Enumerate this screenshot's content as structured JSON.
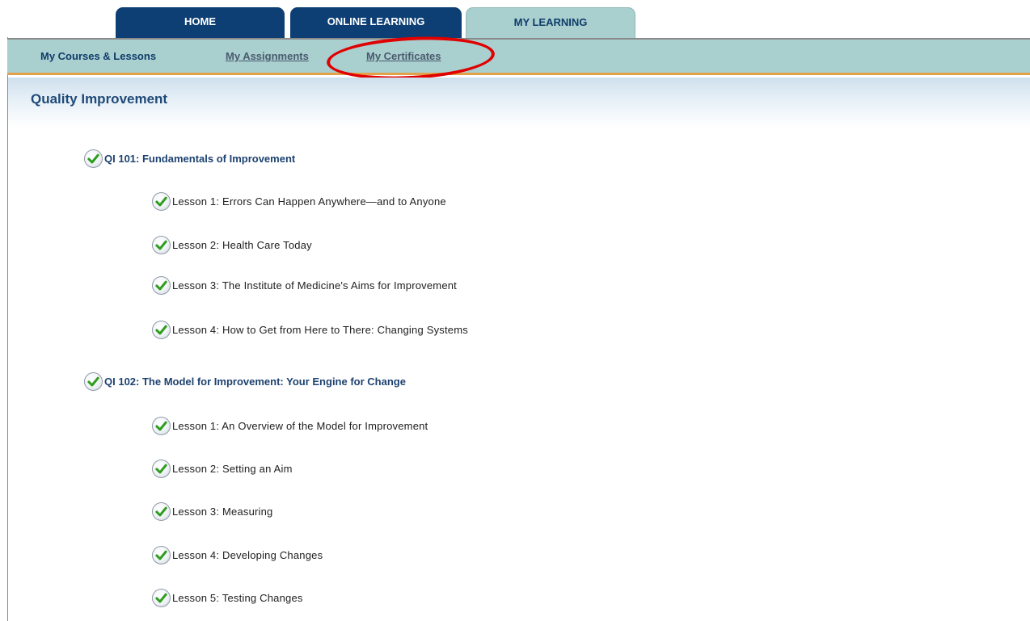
{
  "tabs": [
    {
      "label": "HOME"
    },
    {
      "label": "ONLINE LEARNING"
    },
    {
      "label": "MY LEARNING"
    }
  ],
  "subnav": [
    {
      "label": "My Courses & Lessons"
    },
    {
      "label": "My Assignments"
    },
    {
      "label": "My Certificates"
    }
  ],
  "page": {
    "title": "Quality Improvement"
  },
  "courses": [
    {
      "title": "QI 101: Fundamentals of Improvement",
      "lessons": [
        "Lesson 1: Errors Can Happen Anywhere—and to Anyone",
        "Lesson 2: Health Care Today",
        "Lesson 3: The Institute of Medicine's Aims for Improvement",
        "Lesson 4: How to Get from Here to There: Changing Systems"
      ]
    },
    {
      "title": "QI 102: The Model for Improvement: Your Engine for Change",
      "lessons": [
        "Lesson 1: An Overview of the Model for Improvement",
        "Lesson 2: Setting an Aim",
        "Lesson 3: Measuring",
        "Lesson 4: Developing Changes",
        "Lesson 5: Testing Changes"
      ]
    }
  ],
  "icons": {
    "completed": "green-checkmark-icon"
  },
  "colors": {
    "tab_dark": "#0d3f74",
    "tab_active": "#a9cfcf",
    "subnav_bg": "#a9cfcf",
    "accent_border": "#e3a24a",
    "highlight_circle": "#e00000",
    "check_green": "#2e9d1e"
  }
}
